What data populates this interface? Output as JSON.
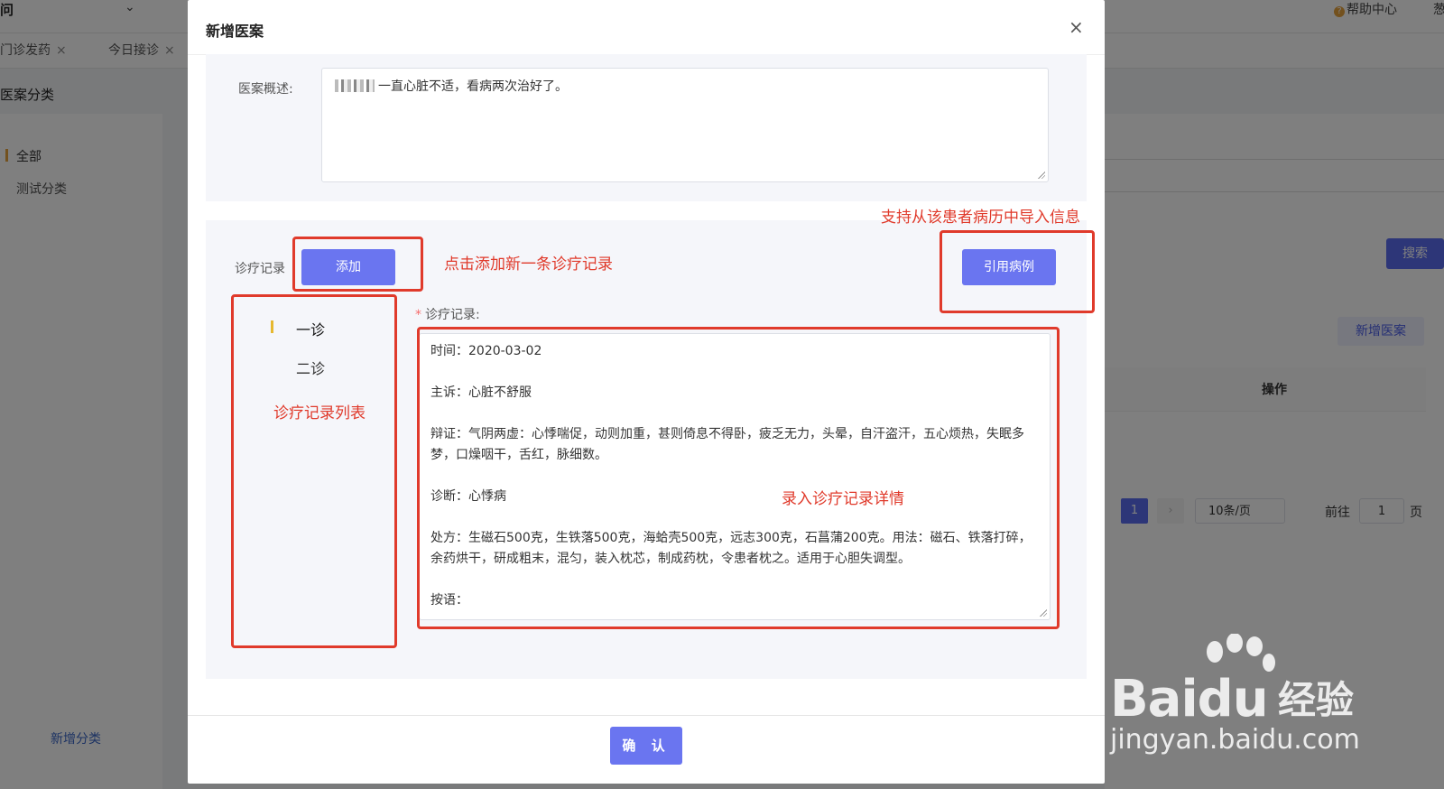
{
  "background": {
    "top_left_title": "问",
    "help_center": "帮助中心",
    "top_right_edge": "葱",
    "tabs": [
      {
        "label": "门诊发药"
      },
      {
        "label": "今日接诊"
      }
    ],
    "tab_close": "×",
    "category_title": "医案分类",
    "categories": [
      {
        "label": "全部"
      },
      {
        "label": "测试分类"
      }
    ],
    "new_category": "新增分类",
    "search_button": "搜索",
    "new_case_button": "新增医案",
    "table_operation_header": "操作",
    "pagination": {
      "current_page": "1",
      "page_size": "10条/页",
      "goto_label": "前往",
      "goto_value": "1",
      "page_unit": "页"
    }
  },
  "modal": {
    "title": "新增医案",
    "close": "×",
    "summary_label": "医案概述:",
    "summary_text": "一直心脏不适，看病两次治好了。",
    "record_label": "诊疗记录",
    "add_button": "添加",
    "cite_button": "引用病例",
    "visits": [
      {
        "label": "一诊"
      },
      {
        "label": "二诊"
      }
    ],
    "detail_label": "诊疗记录:",
    "detail_lines": [
      "时间：2020-03-02",
      "主诉：心脏不舒服",
      "辩证：气阴两虚：心悸喘促，动则加重，甚则倚息不得卧，疲乏无力，头晕，自汗盗汗，五心烦热，失眠多梦，口燥咽干，舌红，脉细数。",
      "诊断：心悸病",
      "处方：生磁石500克，生铁落500克，海蛤壳500克，远志300克，石菖蒲200克。用法：磁石、铁落打碎，余药烘干，研成粗末，混匀，装入枕芯，制成药枕，令患者枕之。适用于心胆失调型。",
      "按语："
    ],
    "confirm_button": "确 认"
  },
  "annotations": {
    "add_hint": "点击添加新一条诊疗记录",
    "import_hint": "支持从该患者病历中导入信息",
    "list_hint": "诊疗记录列表",
    "detail_hint": "录入诊疗记录详情"
  },
  "watermark": {
    "brand": "Bai",
    "brand_du": "du",
    "cn": "经验",
    "url": "jingyan.baidu.com"
  },
  "colors": {
    "primary": "#6a75f0",
    "annotation_red": "#e03a2b",
    "active_marker": "#e6b82f"
  }
}
